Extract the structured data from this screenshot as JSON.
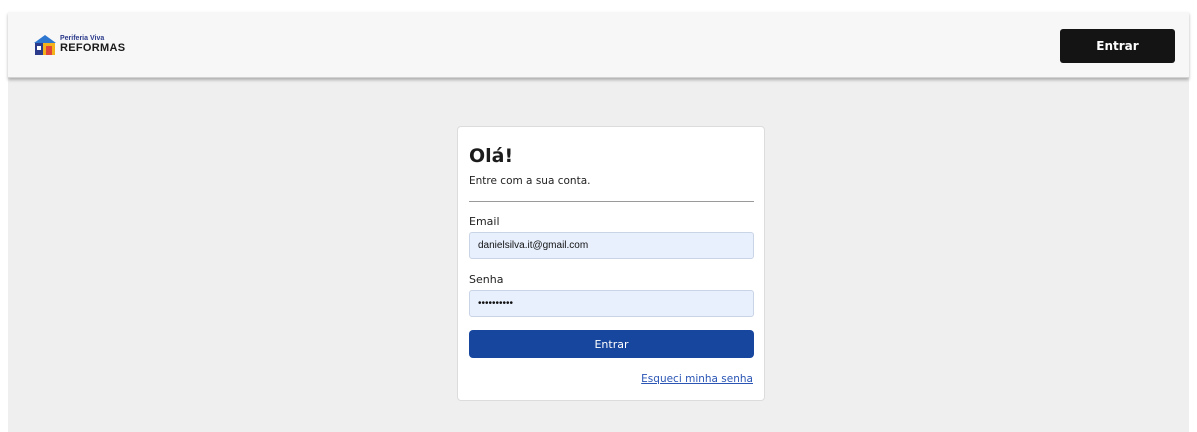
{
  "header": {
    "logo": {
      "line1": "Periferia Viva",
      "line2": "REFORMAS"
    },
    "login_button": "Entrar"
  },
  "card": {
    "title": "Olá!",
    "subtitle": "Entre com a sua conta.",
    "email": {
      "label": "Email",
      "value": "danielsilva.it@gmail.com"
    },
    "password": {
      "label": "Senha",
      "value": "••••••••••"
    },
    "submit_label": "Entrar",
    "forgot_link": "Esqueci minha senha"
  },
  "colors": {
    "header_bg": "#f7f7f8",
    "page_bg": "#efefef",
    "primary_button": "#17469e",
    "dark_button": "#141414",
    "input_autofill_bg": "#e8f0fe",
    "link": "#2a55b5"
  }
}
